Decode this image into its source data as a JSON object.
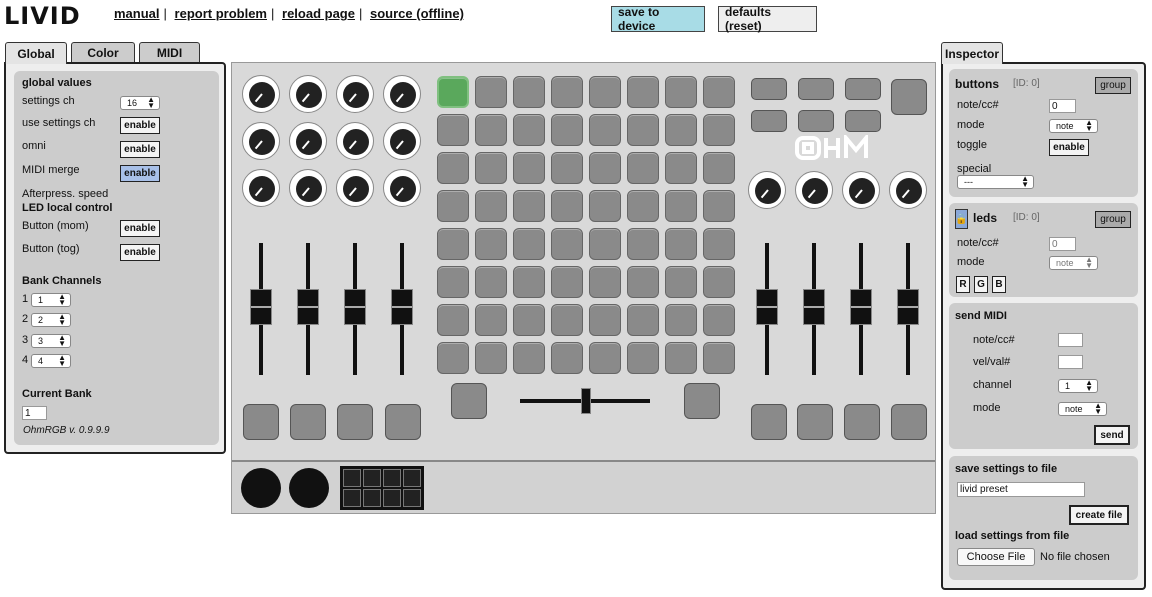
{
  "header": {
    "logo": "LIVID",
    "links": [
      "manual",
      "report problem",
      "reload page",
      "source (offline)"
    ],
    "save_button": "save to device",
    "defaults_button": "defaults (reset)"
  },
  "colors": {
    "save_bg": "#a8dce6",
    "active_pad": "#5aa85c",
    "merge_btn": "#a8c0e8",
    "lock_btn": "#8aa8d8"
  },
  "left": {
    "tabs": [
      "Global",
      "Color",
      "MIDI"
    ],
    "global_values": "global values",
    "settings_ch": "settings ch",
    "settings_ch_value": "16",
    "use_settings_ch": "use settings ch",
    "omni": "omni",
    "midi_merge": "MIDI merge",
    "enable": "enable",
    "afterpress": "Afterpress. speed",
    "led_local": "LED local control",
    "button_mom": "Button (mom)",
    "button_tog": "Button (tog)",
    "bank_channels": "Bank Channels",
    "banks": [
      {
        "n": "1",
        "v": "1"
      },
      {
        "n": "2",
        "v": "2"
      },
      {
        "n": "3",
        "v": "3"
      },
      {
        "n": "4",
        "v": "4"
      }
    ],
    "current_bank": "Current Bank",
    "current_bank_value": "1",
    "version": "OhmRGB v. 0.9.9.9"
  },
  "controller": {
    "brand": "OHM",
    "active_pad": "0"
  },
  "inspector": {
    "tab": "Inspector",
    "buttons": {
      "title": "buttons",
      "id": "[ID: 0]",
      "group": "group",
      "notecc": "note/cc#",
      "notecc_value": "0",
      "mode": "mode",
      "mode_value": "note",
      "toggle": "toggle",
      "enable": "enable",
      "special": "special",
      "special_value": "---"
    },
    "leds": {
      "title": "leds",
      "id": "[ID: 0]",
      "group": "group",
      "notecc": "note/cc#",
      "notecc_value": "0",
      "mode": "mode",
      "mode_value": "note",
      "r": "R",
      "g": "G",
      "b": "B"
    },
    "send": {
      "title": "send MIDI",
      "notecc": "note/cc#",
      "velval": "vel/val#",
      "channel": "channel",
      "channel_value": "1",
      "mode": "mode",
      "mode_value": "note",
      "send": "send"
    },
    "save": {
      "title": "save settings to file",
      "filename": "livid preset",
      "create": "create file",
      "load_title": "load settings from file",
      "choose": "Choose File",
      "no_file": "No file chosen"
    }
  }
}
